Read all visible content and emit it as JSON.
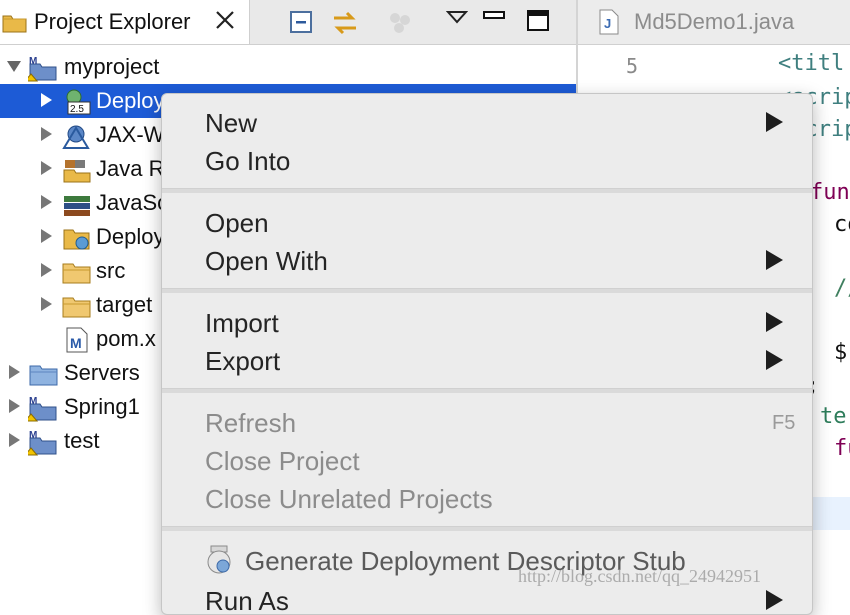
{
  "explorer": {
    "title": "Project Explorer",
    "toolbar": [
      "collapse-all-icon",
      "link-with-editor-icon",
      "focus-icon",
      "view-menu-icon",
      "minimize-icon",
      "maximize-icon"
    ],
    "tree": [
      {
        "label": "myproject",
        "icon": "maven-project-icon",
        "expanded": true
      },
      {
        "label": "Deployment Descriptor: myproject",
        "visible_label": "Deploy",
        "icon": "deployment-descriptor-icon",
        "selected": true
      },
      {
        "label": "JAX-W",
        "icon": "jax-ws-icon"
      },
      {
        "label": "Java R",
        "icon": "java-resources-icon"
      },
      {
        "label": "JavaSc",
        "icon": "javascript-resources-icon"
      },
      {
        "label": "Deploy",
        "icon": "deployed-resources-icon"
      },
      {
        "label": "src",
        "icon": "folder-icon"
      },
      {
        "label": "target",
        "icon": "folder-icon"
      },
      {
        "label": "pom.x",
        "icon": "maven-pom-icon"
      },
      {
        "label": "Servers",
        "icon": "folder-icon"
      },
      {
        "label": "Spring1",
        "icon": "maven-project-icon"
      },
      {
        "label": "test",
        "icon": "maven-project-icon"
      }
    ]
  },
  "editor": {
    "tab_label": "Md5Demo1.java",
    "line_number": "5",
    "code_fragments": [
      "<titl",
      "<scrip",
      "<scrip",
      "func",
      "co",
      "//",
      "$",
      ";",
      "te",
      "fu"
    ]
  },
  "context_menu": {
    "items": [
      {
        "label": "New",
        "submenu": true
      },
      {
        "label": "Go Into"
      },
      {
        "label": "Open"
      },
      {
        "label": "Open With",
        "submenu": true
      },
      {
        "label": "Import",
        "submenu": true
      },
      {
        "label": "Export",
        "submenu": true
      },
      {
        "label": "Refresh",
        "disabled": true,
        "shortcut": "F5"
      },
      {
        "label": "Close Project",
        "disabled": true
      },
      {
        "label": "Close Unrelated Projects",
        "disabled": true
      },
      {
        "label": "Generate Deployment Descriptor Stub",
        "icon": "generate-stub-icon"
      },
      {
        "label": "Run As",
        "submenu": true
      }
    ]
  },
  "watermark": "http://blog.csdn.net/qq_24942951",
  "colors": {
    "selection": "#1d5bd6",
    "menu_bg": "#ececec",
    "code_purple": "#7f0055",
    "code_green": "#2e7d5b"
  }
}
